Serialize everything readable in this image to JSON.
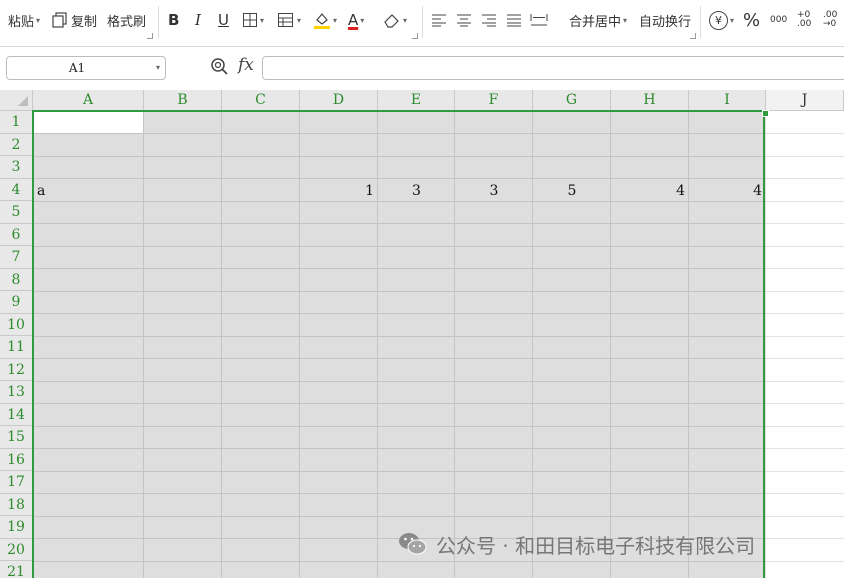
{
  "toolbar": {
    "paste": "粘贴",
    "copy": "复制",
    "format_painter": "格式刷",
    "bold": "B",
    "italic": "I",
    "underline": "U",
    "font_color_glyph": "A",
    "merge_center": "合并居中",
    "wrap_text": "自动换行",
    "currency_glyph": "¥",
    "percent_glyph": "%",
    "thousands_glyph": "000",
    "increase_decimal_glyph": "+0 .00",
    "decrease_decimal_glyph": ".00 →0"
  },
  "formula_bar": {
    "name_box": "A1",
    "fx_label": "fx",
    "formula": ""
  },
  "grid": {
    "columns": [
      "A",
      "B",
      "C",
      "D",
      "E",
      "F",
      "G",
      "H",
      "I",
      "J"
    ],
    "rows": [
      "1",
      "2",
      "3",
      "4",
      "5",
      "6",
      "7",
      "8",
      "9",
      "10",
      "11",
      "12",
      "13",
      "14",
      "15",
      "16",
      "17",
      "18",
      "19",
      "20",
      "21"
    ],
    "row4": {
      "A": "a",
      "D": "1",
      "E": "3",
      "F": "3",
      "G": "5",
      "H": "4",
      "I": "4"
    }
  },
  "colors": {
    "selection_border": "#2e9b3e",
    "header_text": "#2e8b2e",
    "selection_fill": "#dedede",
    "font_color_bar": "#e02020",
    "fill_color_bar": "#ffd400"
  },
  "watermark": "公众号 · 和田目标电子科技有限公司"
}
